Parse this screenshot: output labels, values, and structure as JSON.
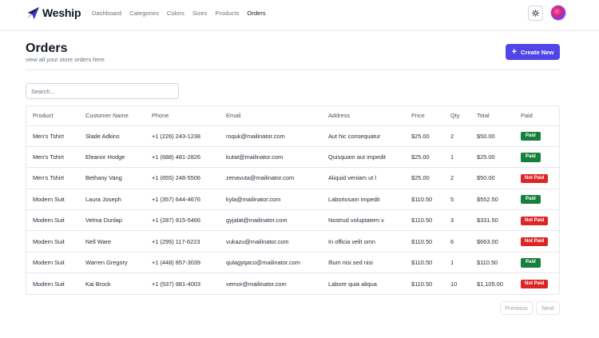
{
  "app": {
    "brand_name": "Weship",
    "colors": {
      "accent": "#4f46e5",
      "paid": "#15803d",
      "not_paid": "#dc2626"
    }
  },
  "nav": {
    "items": [
      {
        "label": "Dashboard",
        "active": false
      },
      {
        "label": "Categories",
        "active": false
      },
      {
        "label": "Colors",
        "active": false
      },
      {
        "label": "Sizes",
        "active": false
      },
      {
        "label": "Products",
        "active": false
      },
      {
        "label": "Orders",
        "active": true
      }
    ],
    "theme_icon": "sun-icon",
    "avatar_icon": "user-avatar"
  },
  "header": {
    "title": "Orders",
    "subtitle": "view all your store orders here",
    "create_label": "Create New",
    "create_icon": "plus-icon"
  },
  "search": {
    "placeholder": "Search...",
    "value": ""
  },
  "table": {
    "columns": [
      "Product",
      "Customer Name",
      "Phone",
      "Email",
      "Address",
      "Price",
      "Qty",
      "Total",
      "Paid"
    ],
    "rows": [
      {
        "product": "Men's Tshirt",
        "customer": "Slade Adkins",
        "phone": "+1 (226) 243-1238",
        "email": "roquk@mailinator.com",
        "address": "Aut hic consequatur",
        "price": "$25.00",
        "qty": "2",
        "total": "$50.00",
        "paid": "Paid"
      },
      {
        "product": "Men's Tshirt",
        "customer": "Eleanor Hodge",
        "phone": "+1 (688) 481-2826",
        "email": "kutat@mailinator.com",
        "address": "Quisquam aut impedit",
        "price": "$25.00",
        "qty": "1",
        "total": "$25.00",
        "paid": "Paid"
      },
      {
        "product": "Men's Tshirt",
        "customer": "Bethany Vang",
        "phone": "+1 (655) 248-5506",
        "email": "zenavuta@mailinator.com",
        "address": "Aliquid veniam ut l",
        "price": "$25.00",
        "qty": "2",
        "total": "$50.00",
        "paid": "Not Paid"
      },
      {
        "product": "Modern Suit",
        "customer": "Laura Joseph",
        "phone": "+1 (357) 644-4676",
        "email": "kyla@mailinator.com",
        "address": "Laboriosam impedit",
        "price": "$110.50",
        "qty": "5",
        "total": "$552.50",
        "paid": "Paid"
      },
      {
        "product": "Modern Suit",
        "customer": "Velma Dunlap",
        "phone": "+1 (287) 915-5466",
        "email": "gyjalat@mailinator.com",
        "address": "Nostrud voluptatem v",
        "price": "$110.50",
        "qty": "3",
        "total": "$331.50",
        "paid": "Not Paid"
      },
      {
        "product": "Modern Suit",
        "customer": "Nell Ware",
        "phone": "+1 (295) 117-6223",
        "email": "vukazu@mailinator.com",
        "address": "In officia velit omn",
        "price": "$110.50",
        "qty": "6",
        "total": "$663.00",
        "paid": "Not Paid"
      },
      {
        "product": "Modern Suit",
        "customer": "Warren Gregory",
        "phone": "+1 (448) 857-3039",
        "email": "qulagyqaco@mailinator.com",
        "address": "Illum nisi sed nisi",
        "price": "$110.50",
        "qty": "1",
        "total": "$110.50",
        "paid": "Paid"
      },
      {
        "product": "Modern Suit",
        "customer": "Kai Brock",
        "phone": "+1 (537) 981-4003",
        "email": "vemor@mailinator.com",
        "address": "Labore quia aliqua",
        "price": "$110.50",
        "qty": "10",
        "total": "$1,105.00",
        "paid": "Not Paid"
      }
    ]
  },
  "pagination": {
    "previous_label": "Previous",
    "next_label": "Next"
  }
}
